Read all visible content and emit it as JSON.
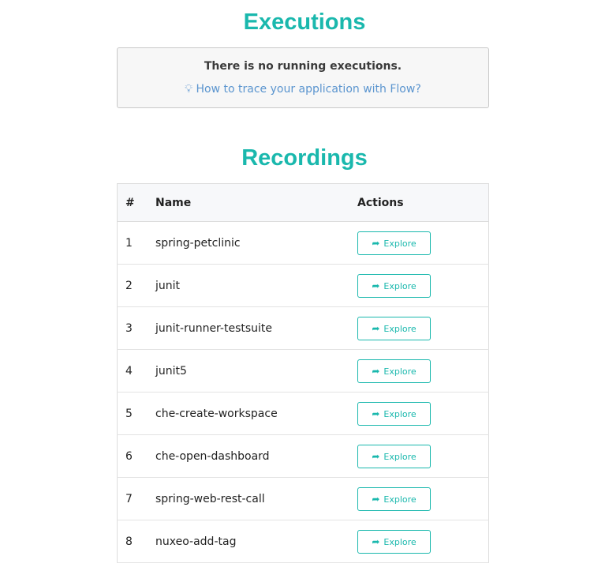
{
  "executions": {
    "title": "Executions",
    "empty_message": "There is no running executions.",
    "help_link": "How to trace your application with Flow?",
    "help_icon": "lightbulb-icon"
  },
  "recordings": {
    "title": "Recordings",
    "columns": [
      "#",
      "Name",
      "Actions"
    ],
    "rows": [
      {
        "num": "1",
        "name": "spring-petclinic",
        "action": "Explore"
      },
      {
        "num": "2",
        "name": "junit",
        "action": "Explore"
      },
      {
        "num": "3",
        "name": "junit-runner-testsuite",
        "action": "Explore"
      },
      {
        "num": "4",
        "name": "junit5",
        "action": "Explore"
      },
      {
        "num": "5",
        "name": "che-create-workspace",
        "action": "Explore"
      },
      {
        "num": "6",
        "name": "che-open-dashboard",
        "action": "Explore"
      },
      {
        "num": "7",
        "name": "spring-web-rest-call",
        "action": "Explore"
      },
      {
        "num": "8",
        "name": "nuxeo-add-tag",
        "action": "Explore"
      }
    ]
  },
  "colors": {
    "accent": "#1ab8ad",
    "link": "#5b95cf"
  }
}
